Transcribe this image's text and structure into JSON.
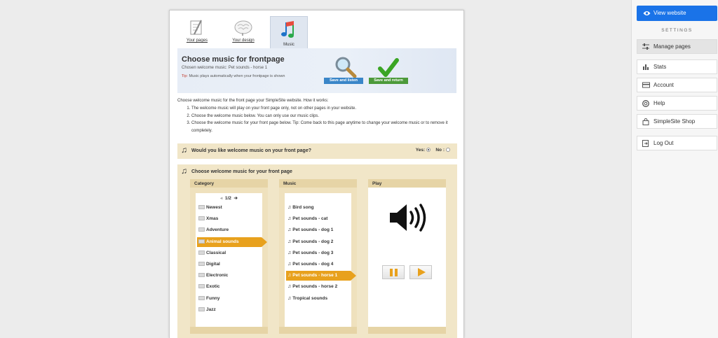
{
  "tabs": [
    {
      "label": "Your pages",
      "icon": "notepad-icon"
    },
    {
      "label": "Your design",
      "icon": "brain-icon"
    },
    {
      "label": "Music",
      "icon": "music-notes-icon"
    }
  ],
  "header": {
    "title": "Choose music for frontpage",
    "chosen": "Chosen welcome music: Pet sounds - horse 1",
    "tip_label": "Tip:",
    "tip_text": " Music plays automatically when your frontpage is shown",
    "save_listen": "Save and listen",
    "save_return": "Save and return",
    "colors": {
      "listen": "#3a86c8",
      "return": "#4c9a3a"
    }
  },
  "intro": {
    "lead": "Choose welcome music for the front page your SimpleSite website. How it works:",
    "steps": [
      "The welcome music will play on your front page only, not on other pages in your website.",
      "Choose the welcome music below. You can only use our music clips.",
      "Choose the welcome music for your front page below. Tip: Come back to this page anytime to change your welcome music or to remove it completely."
    ]
  },
  "question": {
    "title": "Would you like welcome music on your front page?",
    "yes": "Yes:",
    "no": "No :",
    "selected": "yes"
  },
  "chooser": {
    "title": "Choose welcome music for your front page",
    "category_header": "Category",
    "music_header": "Music",
    "play_header": "Play",
    "pager": "1/2",
    "categories": [
      "Newest",
      "Xmas",
      "Adventure",
      "Animal sounds",
      "Classical",
      "Digital",
      "Electronic",
      "Exotic",
      "Funny",
      "Jazz"
    ],
    "selected_category": "Animal sounds",
    "tracks": [
      "Bird song",
      "Pet sounds - cat",
      "Pet sounds - dog 1",
      "Pet sounds - dog 2",
      "Pet sounds - dog 3",
      "Pet sounds - dog 4",
      "Pet sounds - horse 1",
      "Pet sounds - horse 2",
      "Tropical sounds"
    ],
    "selected_track": "Pet sounds - horse 1",
    "accent": "#e8a11d"
  },
  "sidebar": {
    "view_website": "View website",
    "settings": "SETTINGS",
    "items": [
      {
        "label": "Manage pages",
        "icon": "sliders-icon"
      },
      {
        "label": "Stats",
        "icon": "bar-chart-icon"
      },
      {
        "label": "Account",
        "icon": "credit-card-icon"
      },
      {
        "label": "Help",
        "icon": "lifebuoy-icon"
      },
      {
        "label": "SimpleSite Shop",
        "icon": "shopping-bag-icon"
      },
      {
        "label": "Log Out",
        "icon": "logout-icon"
      }
    ],
    "accent": "#1a73e8"
  }
}
